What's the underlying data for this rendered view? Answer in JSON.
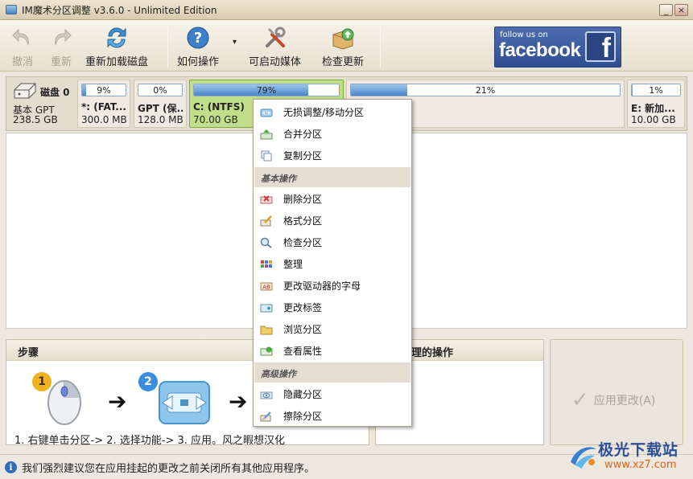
{
  "window": {
    "title": "IM魔术分区调整 v3.6.0 - Unlimited Edition",
    "minimize": "_",
    "close": "×"
  },
  "toolbar": {
    "undo": "撤消",
    "redo": "重新",
    "reload": "重新加载磁盘",
    "howto": "如何操作",
    "howto_dropdown": "▾",
    "bootable": "可启动媒体",
    "update": "检查更新"
  },
  "facebook": {
    "follow": "follow us on",
    "word": "facebook",
    "f": "f"
  },
  "disk": {
    "name": "磁盘 0",
    "type": "基本 GPT",
    "size": "238.5 GB",
    "partitions": [
      {
        "pct_label": "9%",
        "fill": 0.09,
        "label": "*: (FAT...",
        "size": "300.0 MB"
      },
      {
        "pct_label": "0%",
        "fill": 0.0,
        "label": "GPT (保...",
        "size": "128.0 MB"
      },
      {
        "pct_label": "79%",
        "fill": 0.79,
        "label": "C: (NTFS)",
        "size": "70.00 GB"
      },
      {
        "pct_label": "21%",
        "fill": 0.21,
        "label": ")",
        "size": ""
      },
      {
        "pct_label": "1%",
        "fill": 0.01,
        "label": "E: 新加...",
        "size": "10.00 GB"
      }
    ]
  },
  "steps": {
    "title": "步骤",
    "badge1": "1",
    "badge2": "2",
    "arrow": "➔",
    "text": "1. 右键单击分区-> 2. 选择功能-> 3. 应用。风之暇想汉化"
  },
  "pending": {
    "title": "理的操作"
  },
  "apply": {
    "label": "应用更改(A)",
    "check": "✓"
  },
  "status": {
    "icon": "i",
    "text": "我们强烈建议您在应用挂起的更改之前关闭所有其他应用程序。"
  },
  "watermark": {
    "title": "极光下载站",
    "url": "www.xz7.com"
  },
  "context_menu": {
    "items_top": [
      "无损调整/移动分区",
      "合并分区",
      "复制分区"
    ],
    "section_basic": "基本操作",
    "items_basic": [
      "删除分区",
      "格式分区",
      "检查分区",
      "整理",
      "更改驱动器的字母",
      "更改标签",
      "浏览分区",
      "查看属性"
    ],
    "section_advanced": "高级操作",
    "items_advanced": [
      "隐藏分区",
      "擦除分区"
    ]
  }
}
